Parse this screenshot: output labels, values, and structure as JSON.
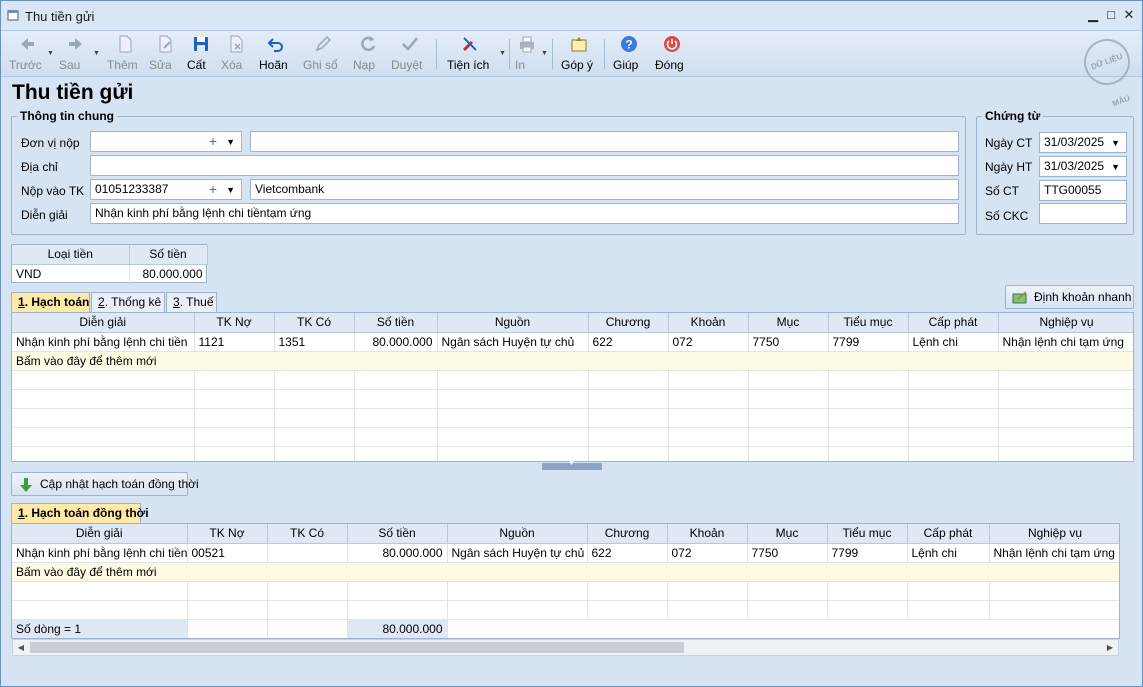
{
  "window": {
    "title": "Thu tiền gửi",
    "minimize": "▁",
    "maximize": "□",
    "close": "✕"
  },
  "toolbar": {
    "back": "Trước",
    "next": "Sau",
    "add": "Thêm",
    "edit": "Sửa",
    "save": "Cất",
    "delete": "Xóa",
    "undo": "Hoãn",
    "post": "Ghi sổ",
    "reload": "Nạp",
    "approve": "Duyệt",
    "utilities": "Tiện ích",
    "print": "In",
    "feedback": "Góp ý",
    "help": "Giúp",
    "close": "Đóng"
  },
  "stamp": "DỮ LIỆU MẪU",
  "page_title": "Thu tiền gửi",
  "general": {
    "legend": "Thông tin chung",
    "payer_label": "Đơn vị nộp",
    "payer_value": "",
    "payer_name": "",
    "address_label": "Địa chỉ",
    "address_value": "",
    "account_label": "Nộp vào TK",
    "account_value": "01051233387",
    "bank_name": "Vietcombank",
    "desc_label": "Diễn giải",
    "desc_value": "Nhận kinh phí bằng lệnh chi tiềntạm ứng"
  },
  "voucher": {
    "legend": "Chứng từ",
    "date_ct_label": "Ngày CT",
    "date_ct": "31/03/2025",
    "date_ht_label": "Ngày HT",
    "date_ht": "31/03/2025",
    "so_ct_label": "Số CT",
    "so_ct": "TTG00055",
    "so_ckc_label": "Số CKC",
    "so_ckc": ""
  },
  "currency_table": {
    "headers": [
      "Loại tiền",
      "Số tiền"
    ],
    "rows": [
      [
        "VND",
        "80.000.000"
      ]
    ]
  },
  "tabs1": {
    "hach_toan_num": "1",
    "hach_toan": ". Hạch toán",
    "thong_ke_num": "2",
    "thong_ke": ". Thống kê",
    "thue_num": "3",
    "thue": ". Thuế"
  },
  "quick_entry_button": "Định khoản nhanh",
  "grid1": {
    "headers": [
      "Diễn giải",
      "TK Nợ",
      "TK Có",
      "Số tiền",
      "Nguồn",
      "Chương",
      "Khoản",
      "Mục",
      "Tiểu mục",
      "Cấp phát",
      "Nghiệp vụ"
    ],
    "rows": [
      [
        "Nhận kinh phí bằng lệnh chi tiền",
        "1121",
        "1351",
        "80.000.000",
        "Ngân sách Huyện tự chủ",
        "622",
        "072",
        "7750",
        "7799",
        "Lệnh chi",
        "Nhận lệnh chi tạm ứng"
      ]
    ],
    "new_row": "Bấm vào đây để thêm mới"
  },
  "update_button": "Cập nhật hạch toán đồng thời",
  "tabs2": {
    "dong_thoi_num": "1",
    "dong_thoi": ". Hạch toán đồng thời"
  },
  "grid2": {
    "headers": [
      "Diễn giải",
      "TK Nợ",
      "TK Có",
      "Số tiền",
      "Nguồn",
      "Chương",
      "Khoản",
      "Mục",
      "Tiểu mục",
      "Cấp phát",
      "Nghiệp vụ"
    ],
    "rows": [
      [
        "Nhận kinh phí bằng lệnh chi tiền",
        "00521",
        "",
        "80.000.000",
        "Ngân sách Huyện tự chủ",
        "622",
        "072",
        "7750",
        "7799",
        "Lệnh chi",
        "Nhận lệnh chi tạm ứng"
      ]
    ],
    "new_row": "Bấm vào đây để thêm mới",
    "row_count": "Số dòng = 1",
    "total": "80.000.000"
  },
  "colors": {
    "accent": "#ffe9a8",
    "background": "#d6e3f3",
    "new_row": "#fdfbe3"
  }
}
